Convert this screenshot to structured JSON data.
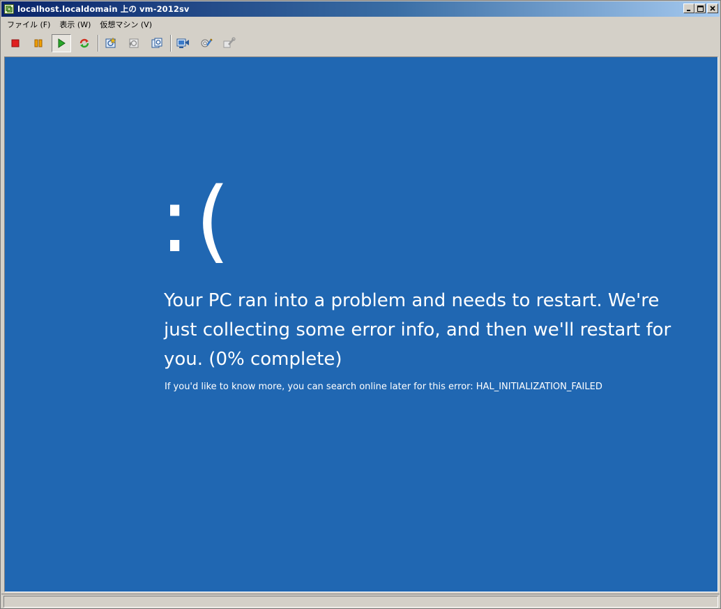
{
  "window": {
    "title": "localhost.localdomain 上の vm-2012sv",
    "minimize_symbol": "_",
    "maximize_symbol": "□",
    "close_symbol": "✕"
  },
  "menu": {
    "items": [
      {
        "label": "ファイル (F)"
      },
      {
        "label": "表示 (W)"
      },
      {
        "label": "仮想マシン (V)"
      }
    ]
  },
  "toolbar": {
    "icons": [
      "stop-icon",
      "pause-icon",
      "play-icon",
      "reset-icon",
      "snapshot-icon",
      "revert-snapshot-icon",
      "snapshot-manager-icon",
      "console-settings-icon",
      "edit-settings-icon",
      "vm-tools-icon"
    ],
    "colors": {
      "stop": "#e02020",
      "pause": "#f0a000",
      "play": "#2aa82a",
      "reset": "#d03020"
    }
  },
  "console": {
    "background": "#2067b2",
    "sad_face": ":(",
    "message": "Your PC ran into a problem and needs to restart. We're just collecting some error info, and then we'll restart for you. (0% complete)",
    "detail": "If you'd like to know more, you can search online later for this error: HAL_INITIALIZATION_FAILED"
  },
  "status": {
    "text": ""
  }
}
